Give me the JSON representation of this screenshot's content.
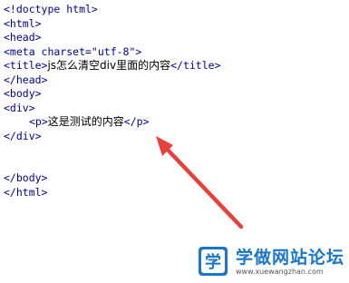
{
  "code": {
    "doctype": "<!doctype html>",
    "html_open": "<html>",
    "head_open": "<head>",
    "meta": "<meta charset=\"utf-8\">",
    "title_open": "<title>",
    "title_text": "js怎么清空div里面的内容",
    "title_close": "</title>",
    "head_close": "</head>",
    "body_open": "<body>",
    "div_open": "<div>",
    "p_open": "<p>",
    "p_text": "这是测试的内容",
    "p_close": "</p>",
    "div_close": "</div>",
    "body_close": "</body>",
    "html_close": "</html>"
  },
  "annotation": {
    "arrow_color": "#e8403a",
    "arrow_icon": "arrow-icon"
  },
  "watermark": {
    "title": "学做网站论坛",
    "url": "www.xuewangzhan.com",
    "logo_glyph": "学",
    "logo_icon": "site-logo-icon",
    "brand_color": "#1976c8"
  }
}
